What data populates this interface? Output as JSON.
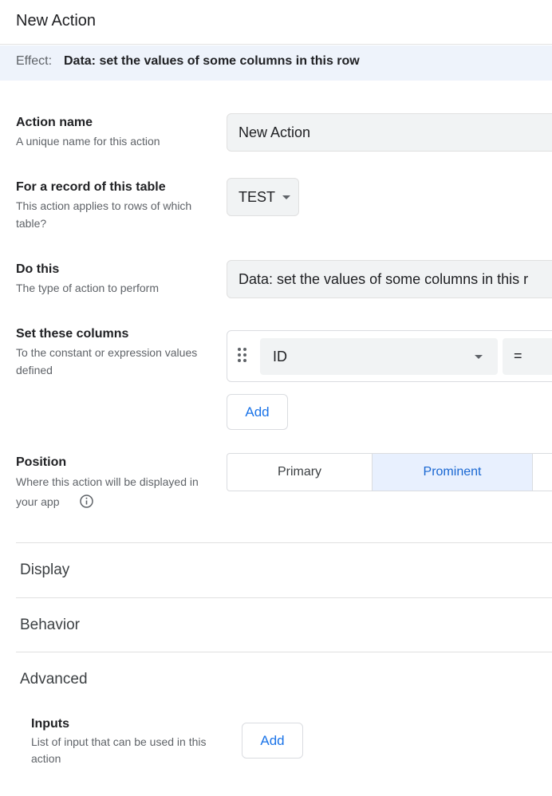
{
  "header": {
    "title": "New Action"
  },
  "effect": {
    "label": "Effect:",
    "value": "Data: set the values of some columns in this row"
  },
  "fields": {
    "action_name": {
      "label": "Action name",
      "help": "A unique name for this action",
      "value": "New Action"
    },
    "table": {
      "label": "For a record of this table",
      "help": "This action applies to rows of which table?",
      "value": "TEST"
    },
    "do_this": {
      "label": "Do this",
      "help": "The type of action to perform",
      "value": "Data: set the values of some columns in this r"
    },
    "set_columns": {
      "label": "Set these columns",
      "help": "To the constant or expression values defined",
      "column": "ID",
      "operator": "=",
      "add_label": "Add"
    },
    "position": {
      "label": "Position",
      "help": "Where this action will be displayed in your app",
      "options": [
        "Primary",
        "Prominent"
      ],
      "selected": "Prominent"
    }
  },
  "sections": {
    "display": "Display",
    "behavior": "Behavior",
    "advanced": "Advanced"
  },
  "inputs": {
    "label": "Inputs",
    "help": "List of input that can be used in this action",
    "add_label": "Add"
  },
  "icons": {
    "info": "info-icon",
    "drag": "drag-handle-icon",
    "dropdown": "chevron-down-icon"
  },
  "colors": {
    "accent": "#1a73e8",
    "effect_bg": "#eef3fb",
    "selected_bg": "#e8f0fe"
  }
}
